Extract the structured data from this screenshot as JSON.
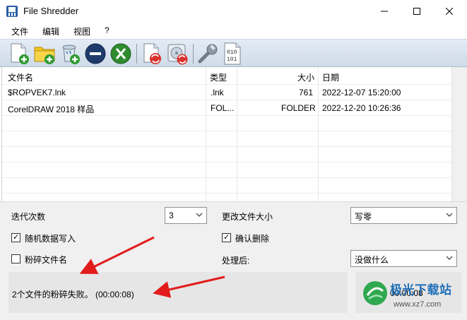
{
  "window": {
    "title": "File Shredder",
    "minimize_glyph": "—",
    "maximize_glyph": "☐",
    "close_glyph": "✕"
  },
  "menu": [
    "文件",
    "编辑",
    "视图",
    "?"
  ],
  "toolbar": {
    "icons": [
      "add-file-icon",
      "add-folder-icon",
      "add-recycle-bin-icon",
      "remove-icon",
      "clear-list-icon",
      "shred-files-icon",
      "shred-disk-icon",
      "settings-wrench-icon",
      "binary-file-icon"
    ],
    "binary_text_top": "010",
    "binary_text_bottom": "101"
  },
  "file_list": {
    "columns": [
      "文件名",
      "类型",
      "大小",
      "日期"
    ],
    "rows": [
      {
        "name": "$ROPVEK7.lnk",
        "type": ".lnk",
        "size": "761",
        "date": "2022-12-07 15:20:00"
      },
      {
        "name": "CorelDRAW 2018 样品",
        "type": "FOL...",
        "size": "FOLDER",
        "date": "2022-12-20 10:26:36"
      }
    ]
  },
  "options": {
    "iterations_label": "迭代次数",
    "iterations_value": "3",
    "change_size_label": "更改文件大小",
    "change_size_value": "写零",
    "random_data_label": "随机数据写入",
    "random_data_checked": true,
    "confirm_delete_label": "确认删除",
    "confirm_delete_checked": true,
    "shred_names_label": "粉碎文件名",
    "shred_names_checked": false,
    "after_label": "处理后:",
    "after_value": "没做什么"
  },
  "status": {
    "message": "2个文件的粉碎失败。 (00:00:08)",
    "elapsed": "00:00:08"
  },
  "watermark": {
    "title": "极光下载站",
    "url": "www.xz7.com"
  },
  "colors": {
    "toolbar_bg": "#d8e2ee",
    "arrow_red": "#e21b1b",
    "green": "#2e8b2e",
    "navy": "#1f3b6e"
  }
}
